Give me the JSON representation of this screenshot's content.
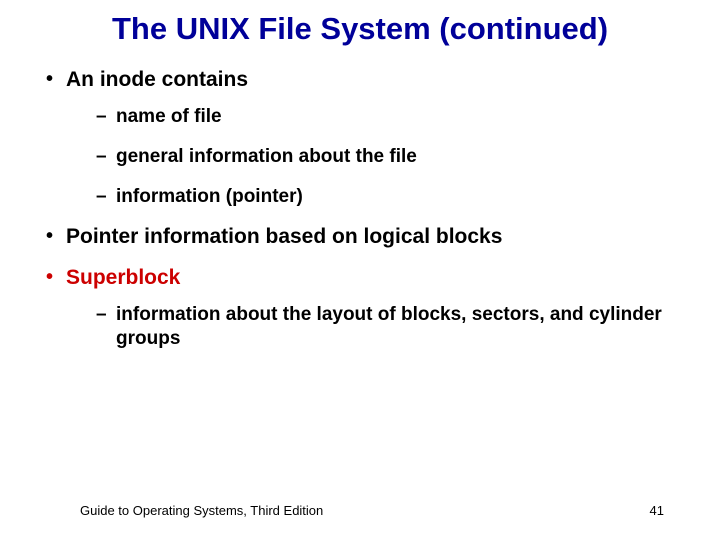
{
  "title": "The UNIX File System (continued)",
  "bullets": {
    "b1": "An inode contains",
    "b1_sub": {
      "s1": "name of file",
      "s2": "general information about the file",
      "s3": "information (pointer)"
    },
    "b2": "Pointer information based on logical blocks",
    "b3": "Superblock",
    "b3_sub": {
      "s1": "information about the layout of blocks, sectors, and cylinder groups"
    }
  },
  "footer": {
    "left": "Guide to Operating Systems, Third Edition",
    "right": "41"
  }
}
